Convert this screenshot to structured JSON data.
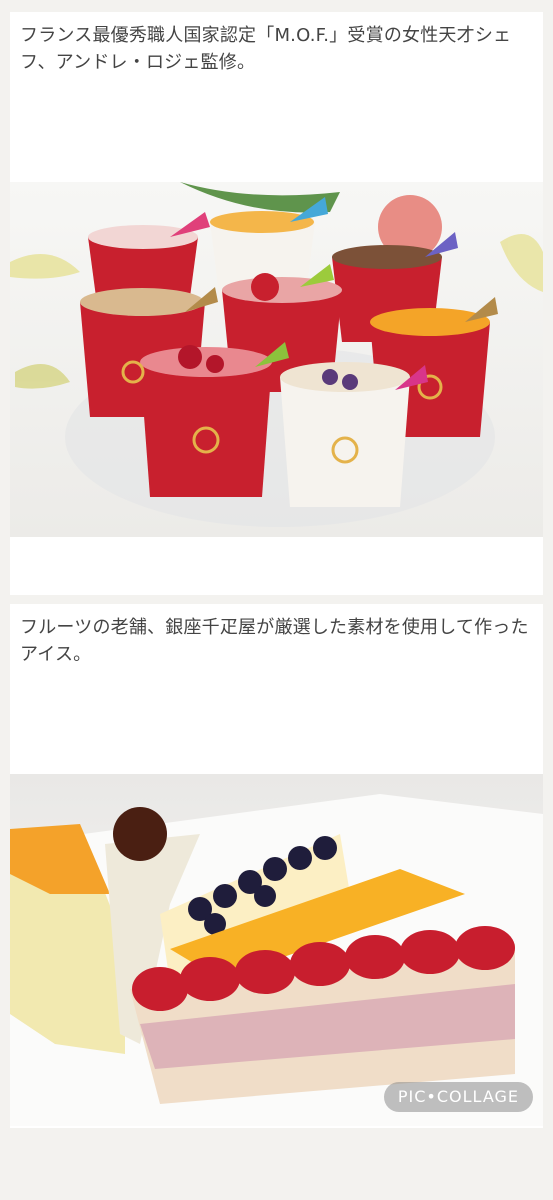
{
  "posts": [
    {
      "caption": "フランス最優秀職人国家認定「M.O.F.」受賞の女性天才シェフ、アンドレ・ロジェ監修。",
      "photo": "ice-cream-cups"
    },
    {
      "caption": "フルーツの老舗、銀座千疋屋が厳選した素材を使用して作ったアイス。",
      "photo": "fruit-ice-cakes"
    }
  ],
  "watermark": "PIC•COLLAGE",
  "colors": {
    "cup_red": "#c8202e",
    "cup_white": "#f6f3ee",
    "bg": "#f3f2ef"
  }
}
